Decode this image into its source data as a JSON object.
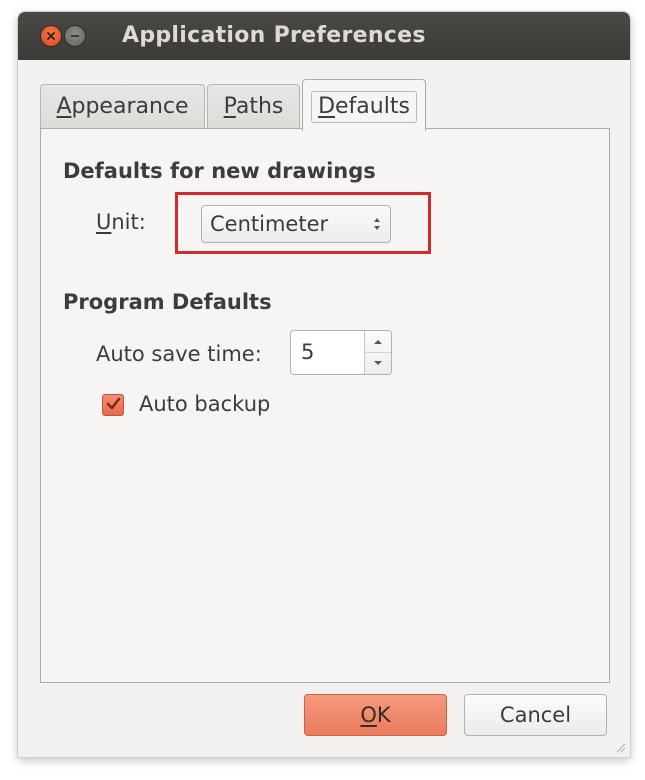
{
  "window": {
    "title": "Application Preferences"
  },
  "tabs": [
    {
      "label": "Appearance",
      "mnemonic": "A",
      "rest": "ppearance",
      "active": false
    },
    {
      "label": "Paths",
      "mnemonic": "P",
      "rest": "aths",
      "active": false
    },
    {
      "label": "Defaults",
      "mnemonic": "D",
      "rest": "efaults",
      "active": true
    }
  ],
  "defaults_section": {
    "title": "Defaults for new drawings",
    "unit_label_mnemonic": "U",
    "unit_label_rest": "nit:",
    "unit_value": "Centimeter"
  },
  "program_section": {
    "title": "Program Defaults",
    "auto_save_label": "Auto save time:",
    "auto_save_value": "5",
    "auto_backup_label": "Auto backup",
    "auto_backup_checked": true
  },
  "buttons": {
    "ok_mnemonic": "O",
    "ok_rest": "K",
    "cancel": "Cancel"
  },
  "colors": {
    "highlight": "#d12c2c",
    "accent": "#ea7c5c",
    "titlebar": "#3b3a37"
  }
}
